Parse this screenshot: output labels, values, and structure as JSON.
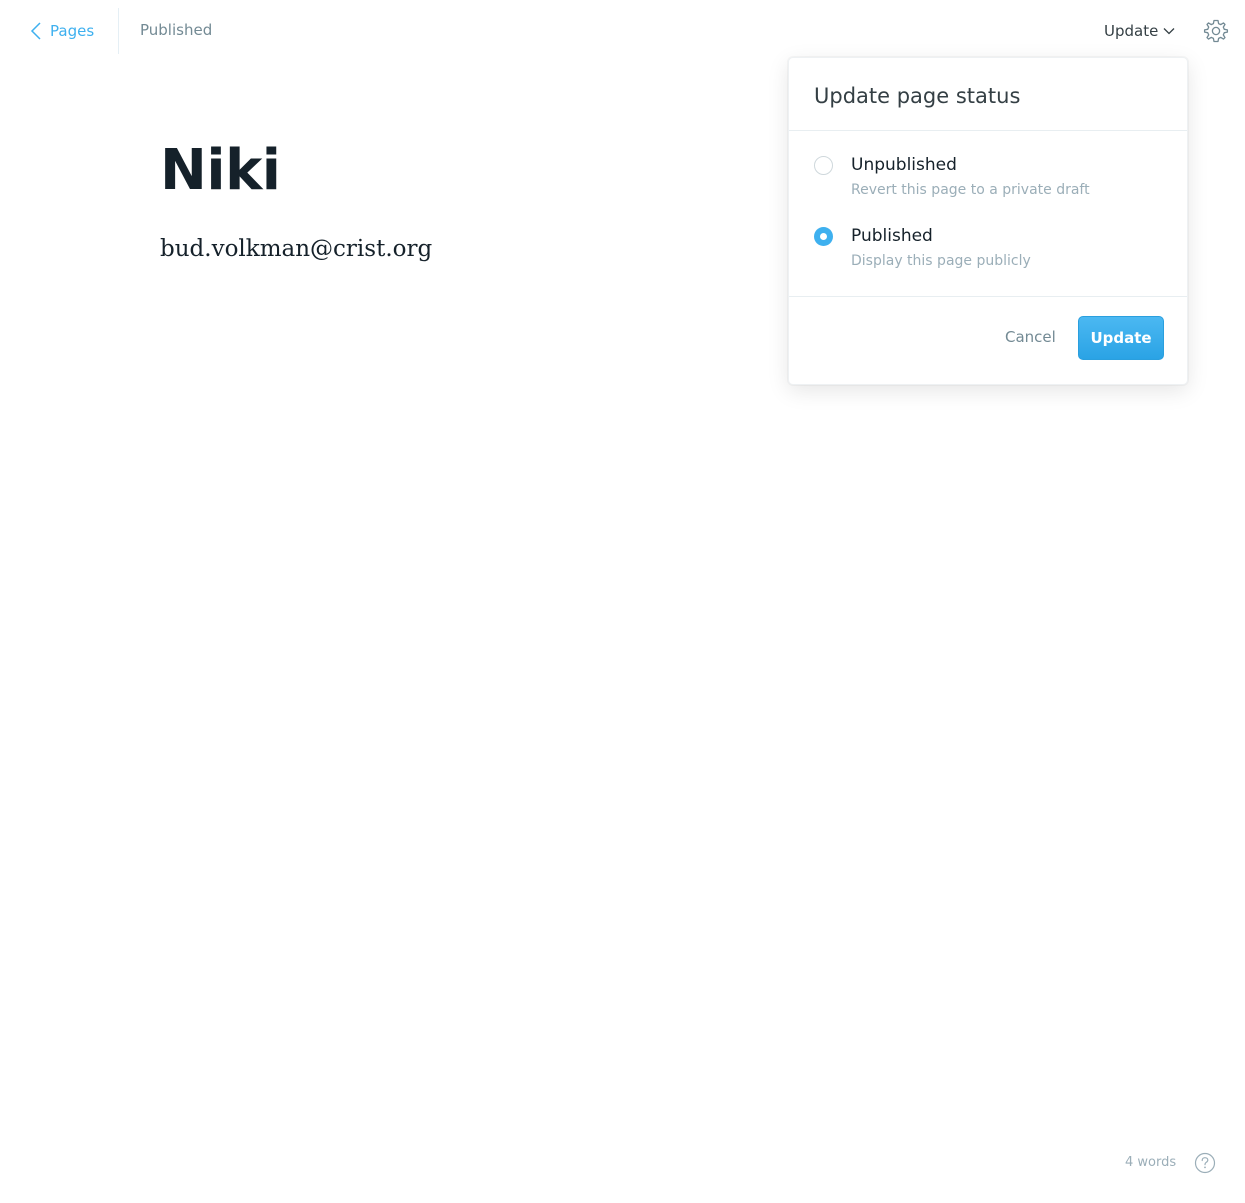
{
  "topbar": {
    "back_label": "Pages",
    "status": "Published",
    "update_label": "Update"
  },
  "post": {
    "title": "Niki",
    "body": "bud.volkman@crist.org"
  },
  "popover": {
    "title": "Update page status",
    "options": [
      {
        "label": "Unpublished",
        "description": "Revert this page to a private draft",
        "checked": false
      },
      {
        "label": "Published",
        "description": "Display this page publicly",
        "checked": true
      }
    ],
    "cancel_label": "Cancel",
    "update_label": "Update"
  },
  "footer": {
    "word_count": "4 words"
  },
  "icons": {
    "back": "chevron-left-icon",
    "dropdown": "chevron-down-icon",
    "settings": "gear-icon",
    "help": "question-circle-icon"
  },
  "colors": {
    "accent": "#3eb0ef",
    "text": "#15212a",
    "muted": "#738a94"
  }
}
